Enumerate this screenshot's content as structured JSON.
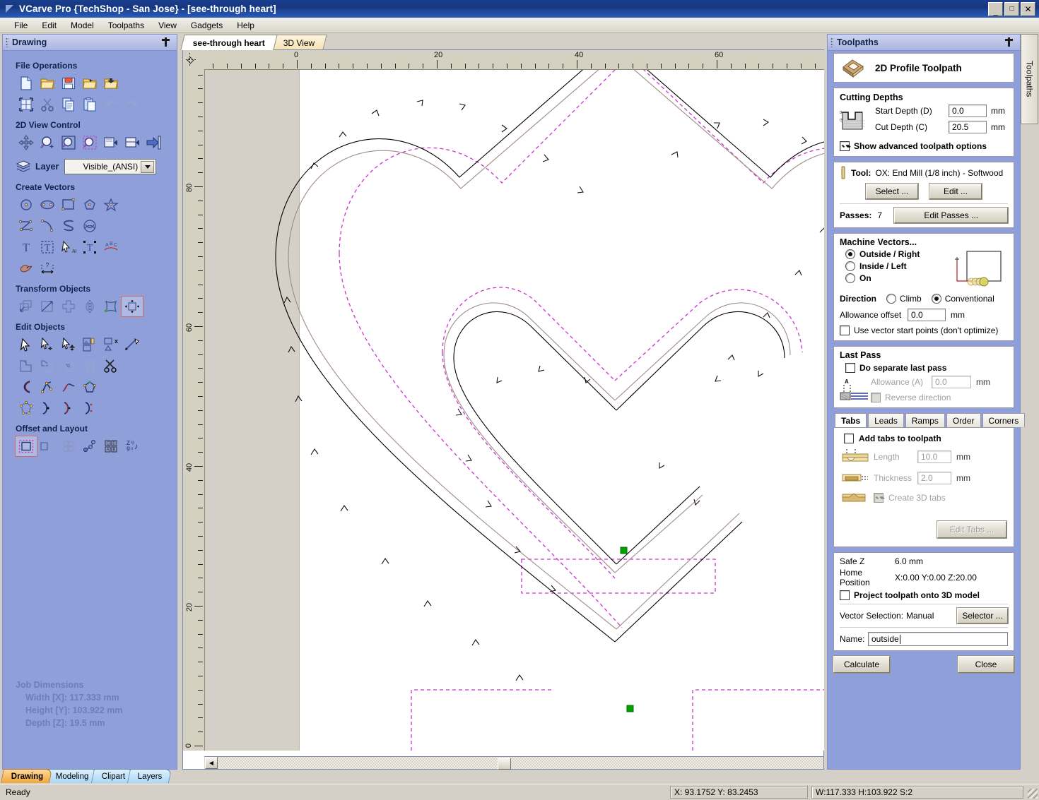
{
  "window": {
    "title": "VCarve Pro {TechShop - San Jose} - [see-through heart]",
    "minimize": "_",
    "maximize": "□",
    "close": "×"
  },
  "menubar": [
    "File",
    "Edit",
    "Model",
    "Toolpaths",
    "View",
    "Gadgets",
    "Help"
  ],
  "left_panel": {
    "title": "Drawing",
    "sections": [
      {
        "title": "File Operations",
        "rows": [
          [
            "new-file-icon",
            "open-folder-icon",
            "save-icon",
            "open-recent-icon",
            "import-icon"
          ],
          [
            "select-all-icon",
            "cut-icon",
            "copy-icon",
            "paste-icon",
            "undo-icon",
            "redo-icon"
          ]
        ]
      },
      {
        "title": "2D View Control",
        "rows": [
          [
            "pan-icon",
            "zoom-in-icon",
            "zoom-extents-icon",
            "zoom-selected-icon",
            "zoom-previous-icon",
            "zoom-region-icon",
            "toggle-panel-icon"
          ]
        ]
      },
      {
        "title": "Create Vectors",
        "rows": [
          [
            "circle-icon",
            "ellipse-icon",
            "rectangle-icon",
            "polygon-icon",
            "star-icon"
          ],
          [
            "polyline-icon",
            "arc-icon",
            "curve-icon",
            "spiral-icon"
          ],
          [
            "text-icon",
            "text-box-icon",
            "text-select-icon",
            "text-transform-icon",
            "text-on-curve-icon"
          ],
          [
            "trace-bitmap-icon",
            "dimension-icon"
          ]
        ]
      },
      {
        "title": "Transform Objects",
        "rows": [
          [
            "move-icon",
            "scale-icon",
            "rotate-icon",
            "mirror-icon",
            "distort-icon",
            "align-icon"
          ]
        ]
      },
      {
        "title": "Edit Objects",
        "rows": [
          [
            "node-edit-icon",
            "point-edit-icon",
            "move-nodes-icon",
            "group-icon",
            "ungroup-icon",
            "measure-icon"
          ],
          [
            "weld-icon",
            "subtract-icon",
            "intersect-icon",
            "crop-icon",
            "trim-icon"
          ],
          [
            "join-open-icon",
            "close-vectors-icon",
            "fit-curve-icon",
            "offset-nodes-icon"
          ],
          [
            "node-array-icon",
            "curve-fit-icon",
            "smooth-icon",
            "tangent-icon"
          ]
        ]
      },
      {
        "title": "Offset and Layout",
        "rows": [
          [
            "offset-icon",
            "array-copy-icon",
            "nest-icon",
            "block-copy-icon",
            "plate-layout-icon",
            "text-wrap-icon"
          ]
        ]
      }
    ],
    "layer": {
      "label": "Layer",
      "value": "Visible_(ANSI)",
      "icon": "layers-icon"
    },
    "job_dimensions": {
      "title": "Job Dimensions",
      "width": "Width  [X]: 117.333 mm",
      "height": "Height [Y]: 103.922 mm",
      "depth": "Depth  [Z]: 19.5 mm"
    },
    "tabs": [
      {
        "label": "Drawing",
        "active": true
      },
      {
        "label": "Modeling",
        "active": false
      },
      {
        "label": "Clipart",
        "active": false
      },
      {
        "label": "Layers",
        "active": false
      }
    ]
  },
  "document_tabs": [
    {
      "label": "see-through heart",
      "active": true
    },
    {
      "label": "3D View",
      "active": false
    }
  ],
  "rulers": {
    "horizontal_ticks": [
      "0",
      "20",
      "40",
      "60"
    ],
    "vertical_ticks": [
      "80",
      "60",
      "40",
      "20",
      "0"
    ]
  },
  "right_panel": {
    "title": "Toolpaths",
    "vertical_tab": "Toolpaths",
    "header": {
      "title": "2D Profile Toolpath",
      "icon": "profile-toolpath-icon"
    },
    "cutting_depths": {
      "title": "Cutting Depths",
      "start_depth_label": "Start Depth (D)",
      "start_depth_value": "0.0",
      "start_depth_unit": "mm",
      "cut_depth_label": "Cut Depth (C)",
      "cut_depth_value": "20.5",
      "cut_depth_unit": "mm",
      "show_advanced_label": "Show advanced toolpath options",
      "show_advanced_checked": true
    },
    "tool": {
      "label": "Tool:",
      "value": "OX: End Mill (1/8 inch) - Softwood",
      "select_button": "Select ...",
      "edit_button": "Edit ...",
      "passes_label": "Passes:",
      "passes_value": "7",
      "edit_passes_button": "Edit Passes ..."
    },
    "machine_vectors": {
      "title": "Machine Vectors...",
      "options": [
        {
          "label": "Outside / Right",
          "selected": true
        },
        {
          "label": "Inside / Left",
          "selected": false
        },
        {
          "label": "On",
          "selected": false
        }
      ],
      "direction_label": "Direction",
      "directions": [
        {
          "label": "Climb",
          "selected": false
        },
        {
          "label": "Conventional",
          "selected": true
        }
      ],
      "allowance_label": "Allowance offset",
      "allowance_value": "0.0",
      "allowance_unit": "mm",
      "start_points_label": "Use vector start points (don't optimize)",
      "start_points_checked": false
    },
    "last_pass": {
      "title": "Last Pass",
      "separate_label": "Do separate last pass",
      "separate_checked": false,
      "allowance_label": "Allowance (A)",
      "allowance_value": "0.0",
      "allowance_unit": "mm",
      "reverse_label": "Reverse direction",
      "reverse_checked": false,
      "diagram_letter": "A"
    },
    "tab_strip": [
      {
        "label": "Tabs",
        "active": true
      },
      {
        "label": "Leads",
        "active": false
      },
      {
        "label": "Ramps",
        "active": false
      },
      {
        "label": "Order",
        "active": false
      },
      {
        "label": "Corners",
        "active": false
      }
    ],
    "tabs_page": {
      "add_tabs_label": "Add tabs to toolpath",
      "add_tabs_checked": false,
      "length_label": "Length",
      "length_value": "10.0",
      "length_unit": "mm",
      "thickness_label": "Thickness",
      "thickness_value": "2.0",
      "thickness_unit": "mm",
      "create_3d_label": "Create 3D tabs",
      "create_3d_checked": true,
      "edit_tabs_button": "Edit Tabs ..."
    },
    "footer": {
      "safe_z_label": "Safe Z",
      "safe_z_value": "6.0 mm",
      "home_label": "Home Position",
      "home_value": "X:0.00 Y:0.00 Z:20.00",
      "project_label": "Project toolpath onto 3D model",
      "project_checked": false,
      "vector_selection_label": "Vector Selection:",
      "vector_selection_value": "Manual",
      "selector_button": "Selector ...",
      "name_label": "Name:",
      "name_value": "outside"
    },
    "actions": {
      "calculate": "Calculate",
      "close": "Close"
    }
  },
  "statusbar": {
    "ready": "Ready",
    "coords": "X: 93.1752 Y: 83.2453",
    "dims": "W:117.333  H:103.922  S:2"
  },
  "colors": {
    "panel_blue": "#8f9fda",
    "titlebar_blue": "#1a3f8f",
    "toolpath_magenta": "#cc33cc",
    "toolpath_green": "#00a000",
    "offset_brown": "#a08b84",
    "active_tab_orange": "#f0a63c"
  }
}
